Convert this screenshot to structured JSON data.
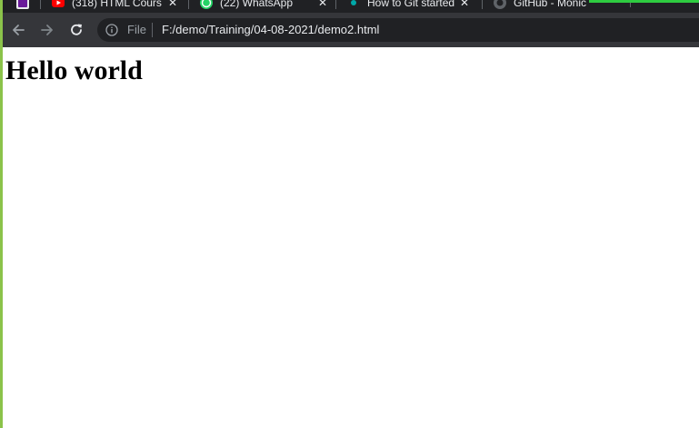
{
  "browser": {
    "tabs": [
      {
        "title": "",
        "icon": "app-icon"
      },
      {
        "title": "(318) HTML Cours",
        "icon": "youtube-icon",
        "close": "✕"
      },
      {
        "title": "(22) WhatsApp",
        "icon": "whatsapp-icon",
        "close": "✕"
      },
      {
        "title": "How to Git started",
        "icon": "page-icon",
        "close": "✕"
      },
      {
        "title": "GitHub - Monic",
        "icon": "github-icon"
      }
    ],
    "toolbar": {
      "back_icon": "arrow-left-icon",
      "forward_icon": "arrow-right-icon",
      "reload_icon": "reload-icon"
    },
    "omnibox": {
      "info_icon": "info-icon",
      "scheme_label": "File",
      "url": "F:/demo/Training/04-08-2021/demo2.html"
    },
    "colors": {
      "tabstrip": "#202124",
      "toolbar": "#35363a",
      "omnibox": "#202124",
      "accent_left": "#8bc34a",
      "download_bar": "#2ecc40"
    }
  },
  "page": {
    "heading": "Hello world"
  }
}
